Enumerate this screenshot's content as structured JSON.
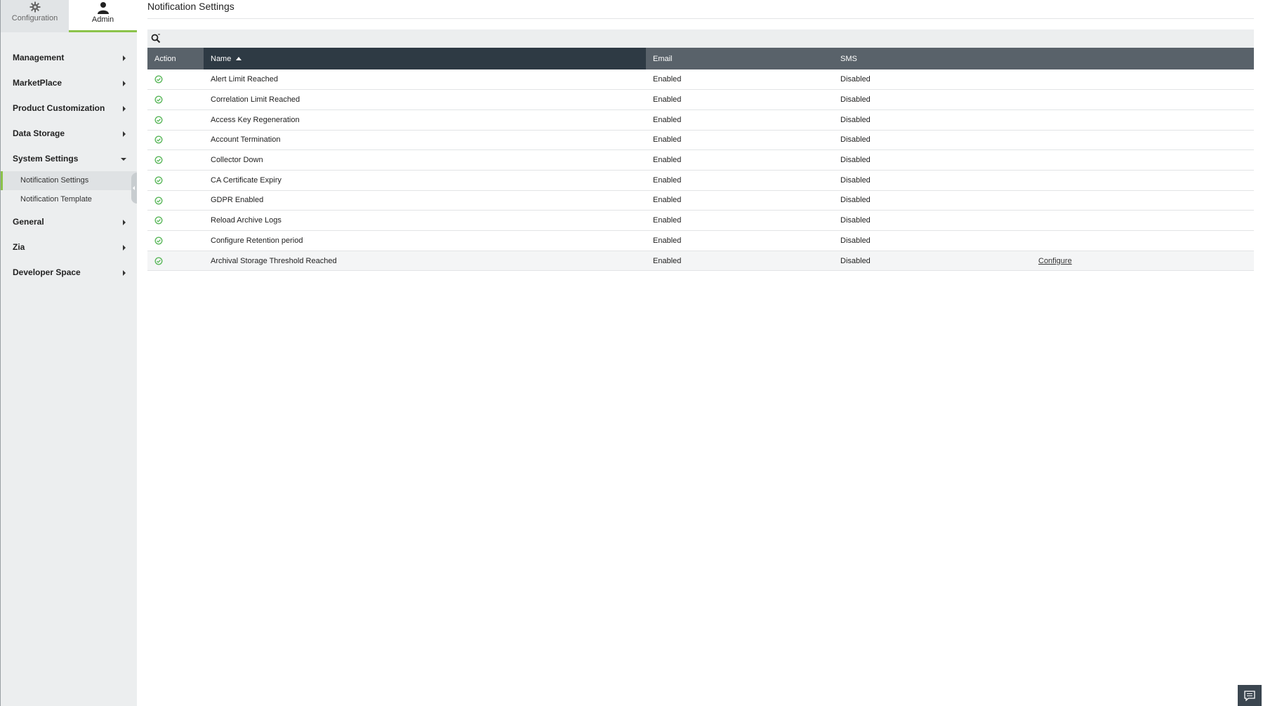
{
  "topnav": {
    "tabs": [
      {
        "label": "Configuration",
        "icon": "gear-icon"
      },
      {
        "label": "Admin",
        "icon": "user-icon"
      }
    ]
  },
  "sidebar": {
    "items": [
      {
        "label": "Management"
      },
      {
        "label": "MarketPlace"
      },
      {
        "label": "Product Customization"
      },
      {
        "label": "Data Storage"
      },
      {
        "label": "System Settings",
        "expanded": true,
        "children": [
          {
            "label": "Notification Settings",
            "active": true
          },
          {
            "label": "Notification Template"
          }
        ]
      },
      {
        "label": "General"
      },
      {
        "label": "Zia"
      },
      {
        "label": "Developer Space"
      }
    ]
  },
  "main": {
    "title": "Notification Settings",
    "table": {
      "columns": [
        "Action",
        "Name",
        "Email",
        "SMS"
      ],
      "sort": {
        "column": "Name",
        "direction": "asc"
      },
      "rows": [
        {
          "name": "Alert Limit Reached",
          "email": "Enabled",
          "sms": "Disabled",
          "extra": ""
        },
        {
          "name": "Correlation Limit Reached",
          "email": "Enabled",
          "sms": "Disabled",
          "extra": ""
        },
        {
          "name": "Access Key Regeneration",
          "email": "Enabled",
          "sms": "Disabled",
          "extra": ""
        },
        {
          "name": "Account Termination",
          "email": "Enabled",
          "sms": "Disabled",
          "extra": ""
        },
        {
          "name": "Collector Down",
          "email": "Enabled",
          "sms": "Disabled",
          "extra": ""
        },
        {
          "name": "CA Certificate Expiry",
          "email": "Enabled",
          "sms": "Disabled",
          "extra": ""
        },
        {
          "name": "GDPR Enabled",
          "email": "Enabled",
          "sms": "Disabled",
          "extra": ""
        },
        {
          "name": "Reload Archive Logs",
          "email": "Enabled",
          "sms": "Disabled",
          "extra": ""
        },
        {
          "name": "Configure Retention period",
          "email": "Enabled",
          "sms": "Disabled",
          "extra": ""
        },
        {
          "name": "Archival Storage Threshold Reached",
          "email": "Enabled",
          "sms": "Disabled",
          "extra": "Configure"
        }
      ]
    }
  },
  "colors": {
    "accent": "#8bc34a",
    "header_dark": "#2e3a44",
    "header": "#59626a",
    "sidebar_bg": "#eceeef"
  }
}
